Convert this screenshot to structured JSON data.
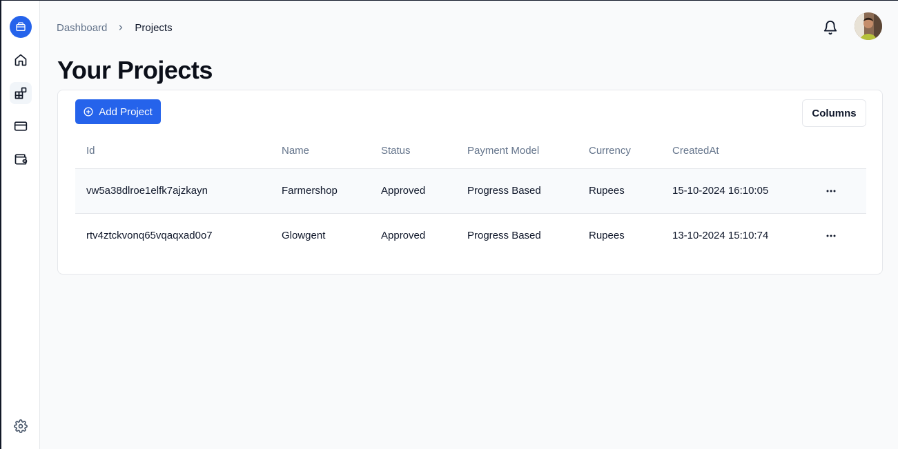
{
  "breadcrumb": {
    "parent": "Dashboard",
    "current": "Projects"
  },
  "page": {
    "title": "Your Projects"
  },
  "toolbar": {
    "add_label": "Add Project",
    "columns_label": "Columns"
  },
  "colors": {
    "accent": "#2563eb",
    "muted": "#64748b",
    "border": "#e5e7eb"
  },
  "sidebar": {
    "items": [
      {
        "icon": "home-icon"
      },
      {
        "icon": "projects-icon"
      },
      {
        "icon": "credit-card-icon"
      },
      {
        "icon": "wallet-icon"
      }
    ],
    "bottom": {
      "icon": "gear-icon"
    }
  },
  "table": {
    "headers": [
      "Id",
      "Name",
      "Status",
      "Payment Model",
      "Currency",
      "CreatedAt"
    ],
    "rows": [
      [
        "vw5a38dlroe1elfk7ajzkayn",
        "Farmershop",
        "Approved",
        "Progress Based",
        "Rupees",
        "15-10-2024 16:10:05"
      ],
      [
        "rtv4ztckvonq65vqaqxad0o7",
        "Glowgent",
        "Approved",
        "Progress Based",
        "Rupees",
        "13-10-2024 15:10:74"
      ]
    ]
  }
}
